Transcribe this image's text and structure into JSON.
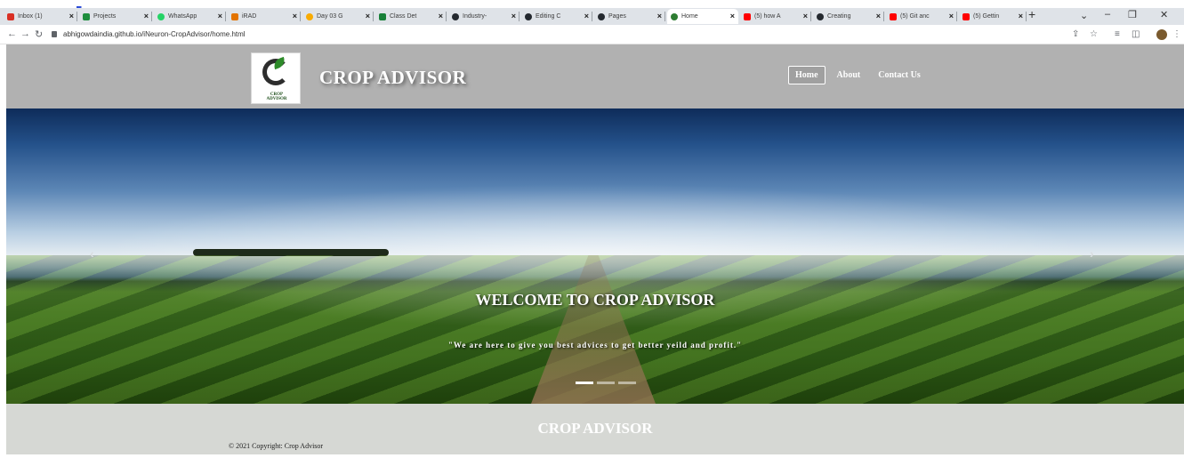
{
  "browser": {
    "tabs": [
      {
        "label": "Inbox (1)",
        "color": "#d93025"
      },
      {
        "label": "Projects",
        "color": "#1e8e3e"
      },
      {
        "label": "WhatsApp",
        "color": "#25d366"
      },
      {
        "label": "iRAD",
        "color": "#e37400"
      },
      {
        "label": "Day 03 G",
        "color": "#f9ab00"
      },
      {
        "label": "Class Det",
        "color": "#188038"
      },
      {
        "label": "Industry-",
        "color": "#24292f"
      },
      {
        "label": "Editing C",
        "color": "#24292f"
      },
      {
        "label": "Pages",
        "color": "#24292f"
      },
      {
        "label": "Home",
        "color": "#2e7d32"
      },
      {
        "label": "(5) how A",
        "color": "#ff0000"
      },
      {
        "label": "Creating",
        "color": "#24292f"
      },
      {
        "label": "(5) Git anc",
        "color": "#ff0000"
      },
      {
        "label": "(5) Gettin",
        "color": "#ff0000"
      }
    ],
    "new_tab": "+",
    "url": "abhigowdaindia.github.io/iNeuron-CropAdvisor/home.html"
  },
  "site": {
    "logo_text": "CROP ADVISOR",
    "brand": "CROP ADVISOR",
    "nav": [
      {
        "label": "Home",
        "active": true
      },
      {
        "label": "About",
        "active": false
      },
      {
        "label": "Contact Us",
        "active": false
      }
    ],
    "hero": {
      "heading": "WELCOME TO CROP ADVISOR",
      "tagline": "\"We are here to give you best advices to get better yeild and profit.\"",
      "prev": "‹",
      "next": "›"
    },
    "footer": {
      "brand": "CROP ADVISOR",
      "copyright": "© 2021 Copyright: Crop Advisor"
    }
  }
}
